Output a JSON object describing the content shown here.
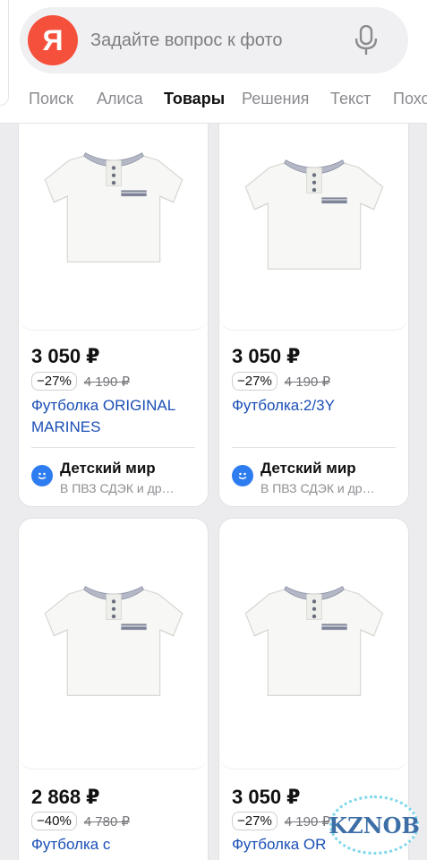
{
  "search": {
    "logo_letter": "Я",
    "placeholder": "Задайте вопрос к фото"
  },
  "tabs": [
    {
      "label": "Поиск",
      "active": false
    },
    {
      "label": "Алиса",
      "active": false
    },
    {
      "label": "Товары",
      "active": true
    },
    {
      "label": "Решения",
      "active": false
    },
    {
      "label": "Текст",
      "active": false
    },
    {
      "label": "Похо",
      "active": false
    }
  ],
  "products": [
    {
      "price": "3 050 ₽",
      "discount": "−27%",
      "old_price": "4 190 ₽",
      "title": "Футболка ORIGINAL MARINES",
      "shop": "Детский мир",
      "delivery": "В ПВЗ СДЭК и др…"
    },
    {
      "price": "3 050 ₽",
      "discount": "−27%",
      "old_price": "4 190 ₽",
      "title": "Футболка:2/3Y",
      "shop": "Детский мир",
      "delivery": "В ПВЗ СДЭК и др…"
    },
    {
      "price": "2 868 ₽",
      "discount": "−40%",
      "old_price": "4 780 ₽",
      "title": "Футболка с"
    },
    {
      "price": "3 050 ₽",
      "discount": "−27%",
      "old_price": "4 190 ₽",
      "title": "Футболка OR"
    }
  ],
  "watermark": "KZNOB",
  "colors": {
    "brand": "#f5503b",
    "link": "#1a4eb5",
    "shop_logo": "#2d7cf0"
  }
}
